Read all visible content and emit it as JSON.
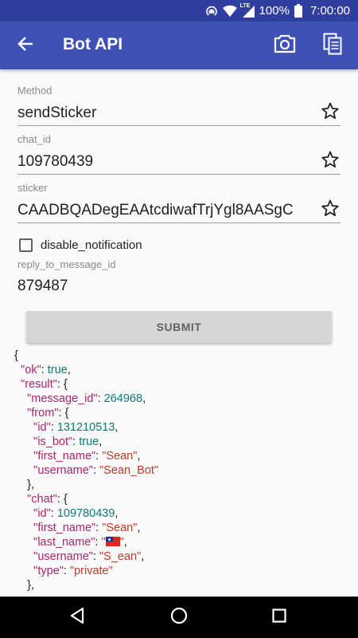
{
  "status_bar": {
    "network": "LTE",
    "battery": "100%",
    "time": "7:00:00"
  },
  "app_bar": {
    "title": "Bot API",
    "icons": [
      "back-arrow-icon",
      "camera-icon",
      "copy-icon"
    ]
  },
  "form": {
    "method": {
      "label": "Method",
      "value": "sendSticker"
    },
    "chat_id": {
      "label": "chat_id",
      "value": "109780439"
    },
    "sticker": {
      "label": "sticker",
      "value": "CAADBQADegEAAtcdiwafTrjYgl8AASgC"
    },
    "disable_notification": {
      "label": "disable_notification",
      "checked": false
    },
    "reply_to_message_id": {
      "label": "reply_to_message_id",
      "value": "879487"
    },
    "submit_label": "SUBMIT"
  },
  "result": {
    "l1": "{",
    "ok_key": "\"ok\"",
    "ok_val": "true",
    "result_key": "\"result\"",
    "message_id_key": "\"message_id\"",
    "message_id_val": "264968",
    "from_key": "\"from\"",
    "from_id_key": "\"id\"",
    "from_id_val": "131210513",
    "is_bot_key": "\"is_bot\"",
    "is_bot_val": "true",
    "from_first_name_key": "\"first_name\"",
    "from_first_name_val": "\"Sean\"",
    "from_username_key": "\"username\"",
    "from_username_val": "\"Sean_Bot\"",
    "chat_key": "\"chat\"",
    "chat_id_key": "\"id\"",
    "chat_id_val": "109780439",
    "chat_first_name_key": "\"first_name\"",
    "chat_first_name_val": "\"Sean\"",
    "chat_last_name_key": "\"last_name\"",
    "chat_username_key": "\"username\"",
    "chat_username_val": "\"S_ean\"",
    "chat_type_key": "\"type\"",
    "chat_type_val": "\"private\""
  },
  "colors": {
    "primary": "#3f51b5",
    "primary_dark": "#303f9f",
    "json_key": "#a6266b",
    "json_number": "#0b7a75",
    "json_string": "#c0392b"
  }
}
